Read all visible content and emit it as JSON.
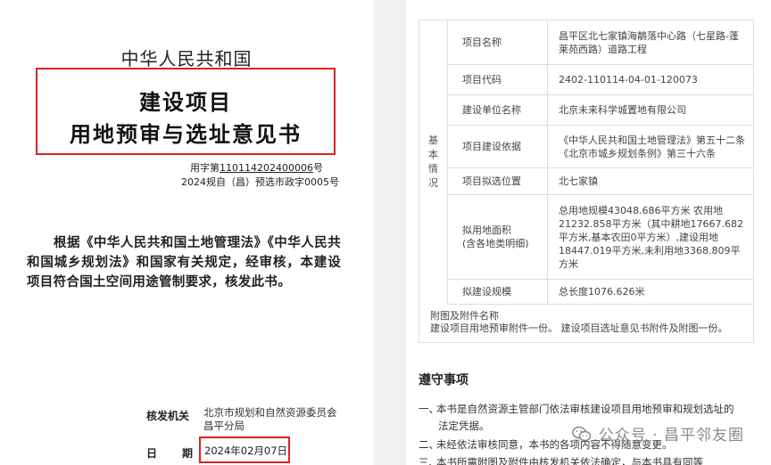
{
  "left": {
    "country": "中华人民共和国",
    "title_line1": "建设项目",
    "title_line2": "用地预审与选址意见书",
    "doc_no_prefix": "用字第",
    "doc_no_number": "110114202400006",
    "doc_no_suffix": "号",
    "doc_no2": "2024规自（昌）预选市政字0005号",
    "body": "根据《中华人民共和国土地管理法》《中华人民共和国城乡规划法》和国家有关规定，经审核，本建设项目符合国土空间用途管制要求，核发此书。",
    "issuer_label": "核发机关",
    "issuer_value": "北京市规划和自然资源委员会昌平分局",
    "date_label_1": "日",
    "date_label_2": "期",
    "date_value": "2024年02月07日"
  },
  "right": {
    "side_label": [
      "基",
      "本",
      "情",
      "况"
    ],
    "rows": [
      {
        "k": "项目名称",
        "v": "昌平区北七家镇海鶄落中心路（七星路-蓬莱苑西路）道路工程"
      },
      {
        "k": "项目代码",
        "v": "2402-110114-04-01-120073"
      },
      {
        "k": "建设单位名称",
        "v": "北京未来科学城置地有限公司"
      },
      {
        "k": "项目建设依据",
        "v": "《中华人民共和国土地管理法》第五十二条 《北京市城乡规划条例》第三十六条"
      },
      {
        "k": "项目拟选位置",
        "v": "北七家镇"
      },
      {
        "k": "拟用地面积（含各地类明细）",
        "k1": "拟用地面积",
        "k2": "(含各地类明细)",
        "v": "总用地规模43048.686平方米 农用地21232.858平方米（其中耕地17667.682平方米,基本农田0平方米）,建设用地18447.019平方米,未利用地3368.809平方米"
      },
      {
        "k": "拟建设规模",
        "v": "总长度1076.626米"
      }
    ],
    "attach_title": "附图及附件名称",
    "attach_text": "建设项目用地预审附件一份。 建设项目选址意见书附件及附图一份。",
    "rules_title": "遵守事项",
    "rules": [
      {
        "num": "一、",
        "text": "本书是自然资源主管部门依法审核建设项目用地预审和规划选址的",
        "cont": "法定凭据。"
      },
      {
        "num": "二、",
        "text": "未经依法审核同意，本书的各项内容不得随意变更。"
      },
      {
        "num": "三、",
        "text": "本书所需附图及附件由核发机关依法确定，与本书具有同等"
      }
    ]
  },
  "watermark": "公众号 · 昌平邻友圈"
}
